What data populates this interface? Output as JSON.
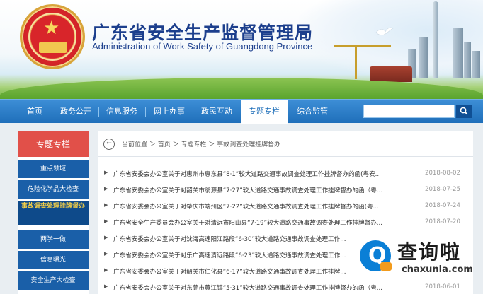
{
  "header": {
    "title_cn": "广东省安全生产监督管理局",
    "title_en": "Administration of Work Safety of Guangdong Province"
  },
  "nav": {
    "items": [
      {
        "label": "首页"
      },
      {
        "label": "政务公开"
      },
      {
        "label": "信息服务"
      },
      {
        "label": "网上办事"
      },
      {
        "label": "政民互动"
      },
      {
        "label": "专题专栏"
      },
      {
        "label": "综合监管"
      }
    ],
    "active_index": 5,
    "search_placeholder": "",
    "search_icon": "search-icon"
  },
  "sidebar": {
    "heading": "专题专栏",
    "items": [
      {
        "label": "重点领域"
      },
      {
        "label": "危险化学品大检查"
      },
      {
        "label": "事故调查处理挂牌督办"
      },
      {
        "label": "两学一做"
      },
      {
        "label": "信息曝光"
      },
      {
        "label": "安全生产大检查"
      }
    ],
    "current_index": 2
  },
  "breadcrumb": {
    "text": "当前位置 ＞ 首页 ＞ 专题专栏 ＞ 事故调查处理挂牌督办"
  },
  "articles": [
    {
      "title": "广东省安委会办公室关于对惠州市惠东县“8·1”较大道路交通事故调查处理工作挂牌督办的函(粤安...",
      "date": "2018-08-02"
    },
    {
      "title": "广东省安委会办公室关于对韶关市翁源县“7·27”较大道路交通事故调查处理工作挂牌督办的函（粤...",
      "date": "2018-07-25"
    },
    {
      "title": "广东省安委会办公室关于对肇庆市端州区“7·22”较大道路交通事故调查处理工作挂牌督办的函(粤...",
      "date": "2018-07-24"
    },
    {
      "title": "广东省安全生产委员会办公室关于对清远市阳山县“7·19”较大道路交通事故调查处理工作挂牌督办...",
      "date": "2018-07-20"
    },
    {
      "title": "广东省安委会办公室关于对沈海高速阳江路段“6·30”较大道路交通事故调查处理工作...",
      "date": ""
    },
    {
      "title": "广东省安委会办公室关于对乐广高速清远路段“6·23”较大道路交通事故调查处理工作...",
      "date": ""
    },
    {
      "title": "广东省安委会办公室关于对韶关市仁化县“6·17”较大道路交通事故调查处理工作挂牌...",
      "date": ""
    },
    {
      "title": "广东省安委会办公室关于对东莞市黄江镇“5·31”较大道路交通事故调查处理工作挂牌督办的函（粤...",
      "date": "2018-06-01"
    }
  ],
  "watermark": {
    "cn": "查询啦",
    "en": "chaxunla.com"
  },
  "colors": {
    "nav_blue": "#1f6fba",
    "sidebar_red": "#e15049",
    "sidebar_blue": "#1a5fa8",
    "current_yellow": "#f6d047",
    "title_blue": "#1c3f8d"
  }
}
